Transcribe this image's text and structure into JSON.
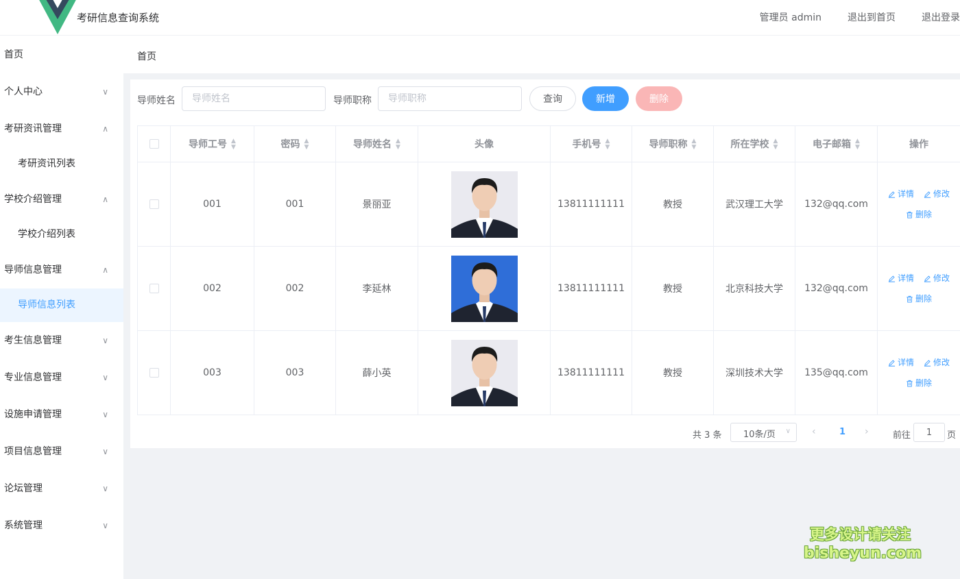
{
  "header": {
    "title": "考研信息查询系统",
    "nav": [
      "管理员 admin",
      "退出到首页",
      "退出登录"
    ]
  },
  "sidebar": {
    "items": [
      {
        "label": "首页",
        "has_arrow": false
      },
      {
        "label": "个人中心",
        "has_arrow": true,
        "expanded": false
      },
      {
        "label": "考研资讯管理",
        "has_arrow": true,
        "expanded": true,
        "children": [
          {
            "label": "考研资讯列表",
            "active": false
          }
        ]
      },
      {
        "label": "学校介绍管理",
        "has_arrow": true,
        "expanded": true,
        "children": [
          {
            "label": "学校介绍列表",
            "active": false
          }
        ]
      },
      {
        "label": "导师信息管理",
        "has_arrow": true,
        "expanded": true,
        "children": [
          {
            "label": "导师信息列表",
            "active": true
          }
        ]
      },
      {
        "label": "考生信息管理",
        "has_arrow": true,
        "expanded": false
      },
      {
        "label": "专业信息管理",
        "has_arrow": true,
        "expanded": false
      },
      {
        "label": "设施申请管理",
        "has_arrow": true,
        "expanded": false
      },
      {
        "label": "项目信息管理",
        "has_arrow": true,
        "expanded": false
      },
      {
        "label": "论坛管理",
        "has_arrow": true,
        "expanded": false
      },
      {
        "label": "系统管理",
        "has_arrow": true,
        "expanded": false
      }
    ]
  },
  "breadcrumb": "首页",
  "search": {
    "name_label": "导师姓名",
    "name_placeholder": "导师姓名",
    "title_label": "导师职称",
    "title_placeholder": "导师职称",
    "query_button": "查询",
    "add_button": "新增",
    "delete_button": "删除"
  },
  "table": {
    "columns": [
      {
        "label": "导师工号",
        "sortable": true
      },
      {
        "label": "密码",
        "sortable": true
      },
      {
        "label": "导师姓名",
        "sortable": true
      },
      {
        "label": "头像",
        "sortable": false
      },
      {
        "label": "手机号",
        "sortable": true
      },
      {
        "label": "导师职称",
        "sortable": true
      },
      {
        "label": "所在学校",
        "sortable": true
      },
      {
        "label": "电子邮箱",
        "sortable": true
      },
      {
        "label": "操作",
        "sortable": false
      }
    ],
    "rows": [
      {
        "id": "001",
        "password": "001",
        "name": "景丽亚",
        "avatar_bg": "#eaeaf0",
        "phone": "13811111111",
        "title": "教授",
        "school": "武汉理工大学",
        "email": "132@qq.com"
      },
      {
        "id": "002",
        "password": "002",
        "name": "李延林",
        "avatar_bg": "#2f6ed8",
        "phone": "13811111111",
        "title": "教授",
        "school": "北京科技大学",
        "email": "132@qq.com"
      },
      {
        "id": "003",
        "password": "003",
        "name": "薛小英",
        "avatar_bg": "#eaeaf0",
        "phone": "13811111111",
        "title": "教授",
        "school": "深圳技术大学",
        "email": "135@qq.com"
      }
    ],
    "actions": {
      "detail": "详情",
      "edit": "修改",
      "delete": "删除"
    }
  },
  "pagination": {
    "total": "共 3 条",
    "page_size": "10条/页",
    "current_page": "1",
    "goto_label": "前往",
    "goto_value": "1",
    "goto_suffix": "页"
  },
  "watermark": {
    "line1": "更多设计请关注",
    "line2": "bisheyun.com"
  },
  "colors": {
    "primary": "#409eff",
    "danger_light": "#fab6b6",
    "logo_green": "#41b883",
    "logo_dark": "#35495e"
  }
}
